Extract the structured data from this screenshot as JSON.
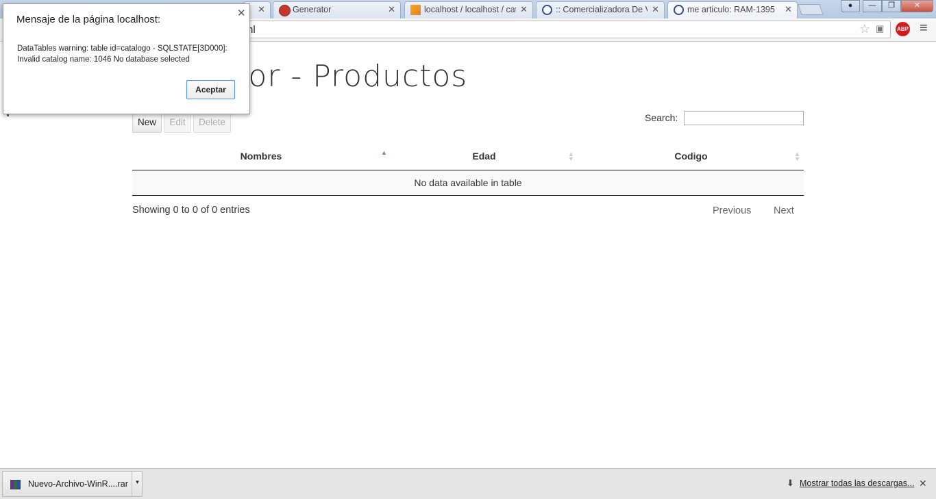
{
  "browser": {
    "tabs": [
      {
        "title": "",
        "icon": "page-icon"
      },
      {
        "title": "Generator",
        "icon": "generator-icon"
      },
      {
        "title": "localhost / localhost / cate",
        "icon": "phpmyadmin-icon"
      },
      {
        "title": ":: Comercializadora De Va",
        "icon": "cvg-icon"
      },
      {
        "title": "me articulo: RAM-1395",
        "icon": "cvg-icon"
      }
    ],
    "address_fragment": "nl",
    "abp_label": "ABP"
  },
  "page": {
    "title": "les Editor - Productos",
    "buttons": {
      "new": "New",
      "edit": "Edit",
      "delete": "Delete"
    },
    "search_label": "Search:",
    "table": {
      "columns": [
        "Nombres",
        "Edad",
        "Codigo"
      ],
      "sorted_column": "Nombres",
      "empty_message": "No data available in table"
    },
    "info": "Showing 0 to 0 of 0 entries",
    "pagination": {
      "previous": "Previous",
      "next": "Next"
    }
  },
  "dialog": {
    "title": "Mensaje de la página localhost:",
    "message_line1": "DataTables warning: table id=catalogo - SQLSTATE[3D000]:",
    "message_line2": "Invalid catalog name: 1046 No database selected",
    "ok_button": "Aceptar"
  },
  "downloads": {
    "file_name": "Nuevo-Archivo-WinR....rar",
    "show_all": "Mostrar todas las descargas..."
  },
  "colors": {
    "sort_active": "#7280c4",
    "sort_inactive": "#c8c8d8",
    "dialog_focus": "#4d90fe",
    "abp_red": "#d41b1b"
  }
}
